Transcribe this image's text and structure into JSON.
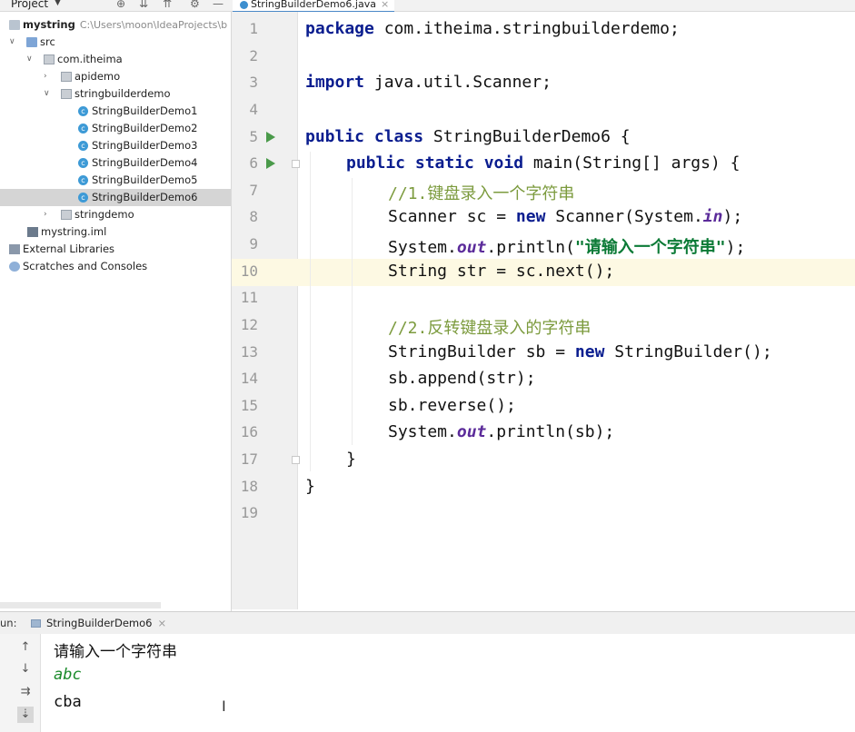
{
  "header": {
    "project_label": "Project",
    "active_tab": "StringBuilderDemo6.java"
  },
  "sidebar": {
    "root_name": "mystring",
    "root_path": "C:\\Users\\moon\\IdeaProjects\\b",
    "items": [
      {
        "label": "src"
      },
      {
        "label": "com.itheima"
      },
      {
        "label": "apidemo"
      },
      {
        "label": "stringbuilderdemo"
      },
      {
        "label": "StringBuilderDemo1"
      },
      {
        "label": "StringBuilderDemo2"
      },
      {
        "label": "StringBuilderDemo3"
      },
      {
        "label": "StringBuilderDemo4"
      },
      {
        "label": "StringBuilderDemo5"
      },
      {
        "label": "StringBuilderDemo6"
      },
      {
        "label": "stringdemo"
      },
      {
        "label": "mystring.iml"
      },
      {
        "label": "External Libraries"
      },
      {
        "label": "Scratches and Consoles"
      }
    ]
  },
  "editor": {
    "line_numbers": [
      "1",
      "2",
      "3",
      "4",
      "5",
      "6",
      "7",
      "8",
      "9",
      "10",
      "11",
      "12",
      "13",
      "14",
      "15",
      "16",
      "17",
      "18",
      "19"
    ],
    "current_line": "10",
    "code": {
      "l1_kw": "package",
      "l1_rest": " com.itheima.stringbuilderdemo;",
      "l3_kw": "import",
      "l3_rest": " java.util.Scanner;",
      "l5_kw": "public class",
      "l5_rest": " StringBuilderDemo6 {",
      "l6_kw": "public static void",
      "l6_rest": " main(String[] args) {",
      "l7_comment": "//1.键盘录入一个字符串",
      "l8_a": "Scanner sc = ",
      "l8_kw": "new",
      "l8_b": " Scanner(System.",
      "l8_fld": "in",
      "l8_c": ");",
      "l9_a": "System.",
      "l9_fld": "out",
      "l9_b": ".println(",
      "l9_str": "\"请输入一个字符串\"",
      "l9_c": ");",
      "l10": "String str = sc.next();",
      "l12_comment": "//2.反转键盘录入的字符串",
      "l13_a": "StringBuilder sb = ",
      "l13_kw": "new",
      "l13_b": " StringBuilder();",
      "l14": "sb.append(str);",
      "l15": "sb.reverse();",
      "l16_a": "System.",
      "l16_fld": "out",
      "l16_b": ".println(sb);",
      "l17": "}",
      "l18": "}"
    }
  },
  "run_panel": {
    "label": "un:",
    "tab_label": "StringBuilderDemo6",
    "output": [
      "请输入一个字符串",
      "abc",
      "cba"
    ]
  },
  "colors": {
    "keyword": "#0a1d8f",
    "comment": "#7c9b3e",
    "string": "#0b7a36",
    "field": "#5b2b9a",
    "current_line_bg": "#fdf9e3",
    "selection_bg": "#d5d5d5"
  }
}
